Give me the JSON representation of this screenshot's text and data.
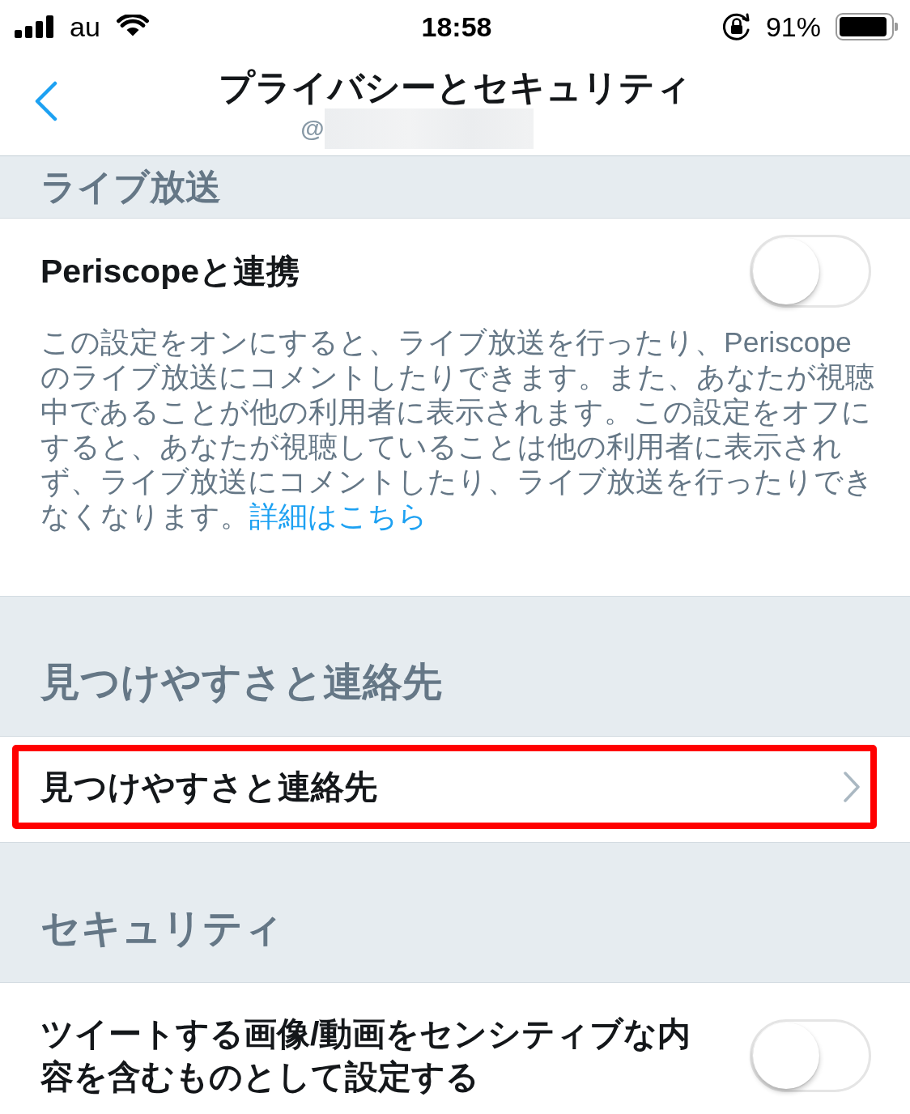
{
  "status_bar": {
    "carrier": "au",
    "time": "18:58",
    "battery_percent": "91%"
  },
  "nav_bar": {
    "title": "プライバシーとセキュリティ",
    "subtitle": "@",
    "username_redacted": true
  },
  "sections": [
    {
      "header": "ライブ放送",
      "rows": [
        {
          "kind": "toggle",
          "label": "Periscopeと連携",
          "on": false,
          "description": "この設定をオンにすると、ライブ放送を行ったり、Periscopeのライブ放送にコメントしたりできます。また、あなたが視聴中であることが他の利用者に表示されます。この設定をオフにすると、あなたが視聴していることは他の利用者に表示されず、ライブ放送にコメントしたり、ライブ放送を行ったりできなくなります。",
          "link": "詳細はこちら"
        }
      ]
    },
    {
      "header": "見つけやすさと連絡先",
      "rows": [
        {
          "kind": "disclosure",
          "label": "見つけやすさと連絡先",
          "highlighted": true
        }
      ]
    },
    {
      "header": "セキュリティ",
      "rows": [
        {
          "kind": "toggle",
          "label": "ツイートする画像/動画をセンシティブな内容を含むものとして設定する",
          "on": false
        }
      ]
    }
  ]
}
